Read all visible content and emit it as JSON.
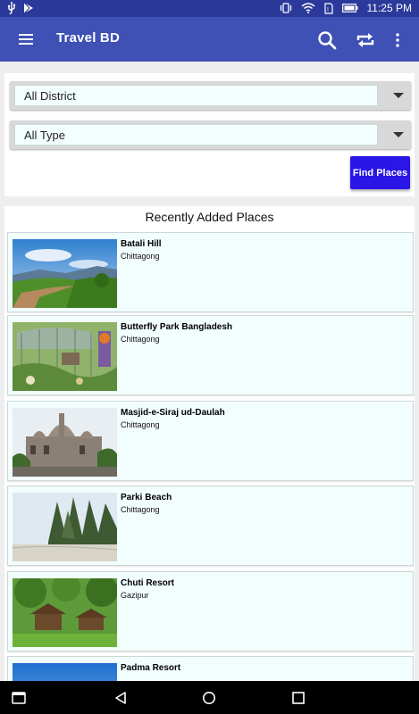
{
  "status_bar": {
    "time": "11:25 PM",
    "icons": [
      "usb-icon",
      "play-store-icon",
      "vibrate-icon",
      "wifi-icon",
      "sim-icon",
      "battery-icon"
    ]
  },
  "app_bar": {
    "title": "Travel BD",
    "background": "#3f51b5",
    "actions": [
      "search-icon",
      "sync-icon",
      "overflow-menu-icon"
    ]
  },
  "filters": {
    "district": {
      "selected": "All District"
    },
    "type": {
      "selected": "All Type"
    },
    "find_button_label": "Find Places",
    "button_color": "#2a16e6"
  },
  "recent": {
    "heading": "Recently Added Places",
    "places": [
      {
        "name": "Batali Hill",
        "district": "Chittagong"
      },
      {
        "name": "Butterfly Park Bangladesh",
        "district": "Chittagong"
      },
      {
        "name": "Masjid-e-Siraj ud-Daulah",
        "district": "Chittagong"
      },
      {
        "name": "Parki Beach",
        "district": "Chittagong"
      },
      {
        "name": "Chuti Resort",
        "district": "Gazipur"
      },
      {
        "name": "Padma Resort",
        "district": ""
      }
    ]
  },
  "nav_bar": {
    "buttons": [
      "recents-icon",
      "back-icon",
      "home-icon",
      "overview-icon"
    ]
  }
}
